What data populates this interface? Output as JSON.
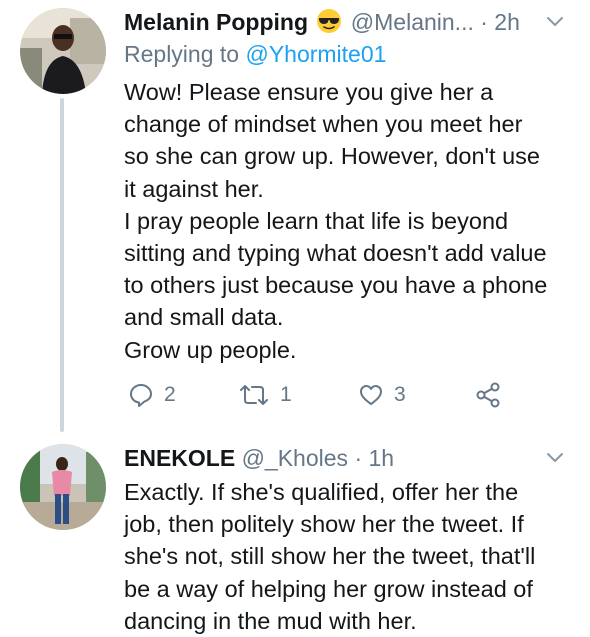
{
  "tweets": [
    {
      "name": "Melanin Popping",
      "emoji": "smiling-face-with-sunglasses",
      "handle": "@Melanin...",
      "time": "· 2h",
      "replying_prefix": "Replying to",
      "replying_to": "@Yhormite01",
      "lines": [
        "Wow! Please ensure you give her a",
        "change of mindset when you meet her",
        "so she can grow up. However, don't use",
        "it against her.",
        "I pray people learn that life is beyond",
        "sitting and typing what doesn't add value",
        "to others just because you have a phone",
        "and small data.",
        "Grow up people."
      ],
      "actions": {
        "replies": "2",
        "retweets": "1",
        "likes": "3"
      }
    },
    {
      "name": "ENEKOLE",
      "handle": "@_Kholes",
      "time": "· 1h",
      "lines": [
        "Exactly. If she's qualified, offer her the",
        "job, then politely show her the tweet. If",
        "she's not, still show her the tweet, that'll",
        "be a way of helping her grow instead of",
        "dancing in the mud with her."
      ]
    }
  ],
  "colors": {
    "text": "#14171a",
    "muted": "#657786",
    "link": "#1da1f2",
    "thread_line": "#ccd6dd"
  }
}
